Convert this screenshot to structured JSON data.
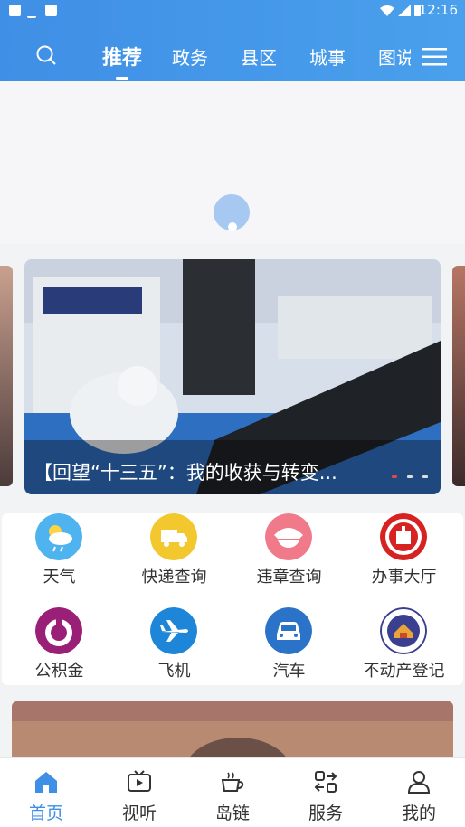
{
  "status_bar": {
    "time": "12:16"
  },
  "top_tabs": [
    {
      "label": "推荐",
      "active": true
    },
    {
      "label": "政务"
    },
    {
      "label": "县区"
    },
    {
      "label": "城事"
    },
    {
      "label": "图说"
    }
  ],
  "carousel": {
    "caption": "【回望“十三五”：我的收获与转变...",
    "dots": 3,
    "active_dot": 0
  },
  "services": [
    {
      "label": "天气",
      "icon": "weather-icon",
      "color": "#4fb3ef"
    },
    {
      "label": "快递查询",
      "icon": "truck-icon",
      "color": "#f2c82e"
    },
    {
      "label": "违章查询",
      "icon": "police-cap-icon",
      "color": "#f07a8a"
    },
    {
      "label": "办事大厅",
      "icon": "service-hall-logo-icon",
      "color": "#d72222"
    },
    {
      "label": "公积金",
      "icon": "housing-fund-icon",
      "color": "#9a1f77"
    },
    {
      "label": "飞机",
      "icon": "airplane-icon",
      "color": "#1d86d8"
    },
    {
      "label": "汽车",
      "icon": "car-icon",
      "color": "#2a73c9"
    },
    {
      "label": "不动产登记",
      "icon": "real-estate-emblem-icon",
      "color": "#3a3f8f"
    }
  ],
  "bottom_tabs": [
    {
      "label": "首页",
      "icon": "home-icon",
      "active": true
    },
    {
      "label": "视听",
      "icon": "tv-icon"
    },
    {
      "label": "岛链",
      "icon": "coffee-cup-icon"
    },
    {
      "label": "服务",
      "icon": "services-grid-icon"
    },
    {
      "label": "我的",
      "icon": "user-icon"
    }
  ],
  "colors": {
    "accent": "#3f8fe6",
    "active_dot": "#e24646"
  }
}
